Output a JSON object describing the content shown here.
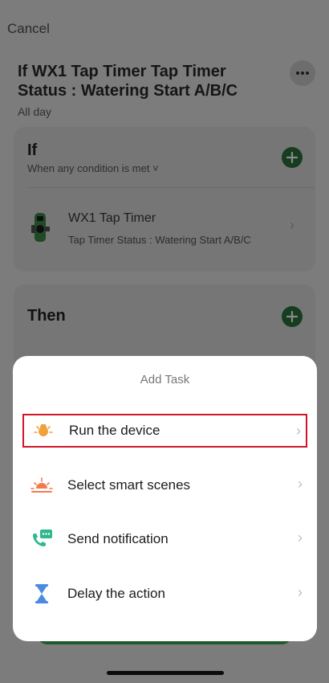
{
  "header": {
    "cancel_label": "Cancel",
    "title": "If WX1 Tap Timer Tap Timer Status : Watering Start A/B/C",
    "subtitle": "All day",
    "more_icon": "more-dots-icon"
  },
  "if_card": {
    "heading": "If",
    "condition_selector": "When any condition is met ˅",
    "device": {
      "name": "WX1 Tap Timer",
      "status": "Tap Timer Status : Watering Start A/B/C",
      "icon": "tap-timer-device-icon"
    }
  },
  "then_card": {
    "heading": "Then"
  },
  "sheet": {
    "title": "Add Task",
    "items": [
      {
        "label": "Run the device",
        "icon": "lightbulb-icon",
        "color": "#f0a23a"
      },
      {
        "label": "Select smart scenes",
        "icon": "sunrise-icon",
        "color": "#f07b4e"
      },
      {
        "label": "Send notification",
        "icon": "phone-message-icon",
        "color": "#2fb88f"
      },
      {
        "label": "Delay the action",
        "icon": "hourglass-icon",
        "color": "#4a8ae0"
      }
    ]
  },
  "colors": {
    "accent_green": "#1f7a3a",
    "highlight_red": "#d0152a"
  }
}
